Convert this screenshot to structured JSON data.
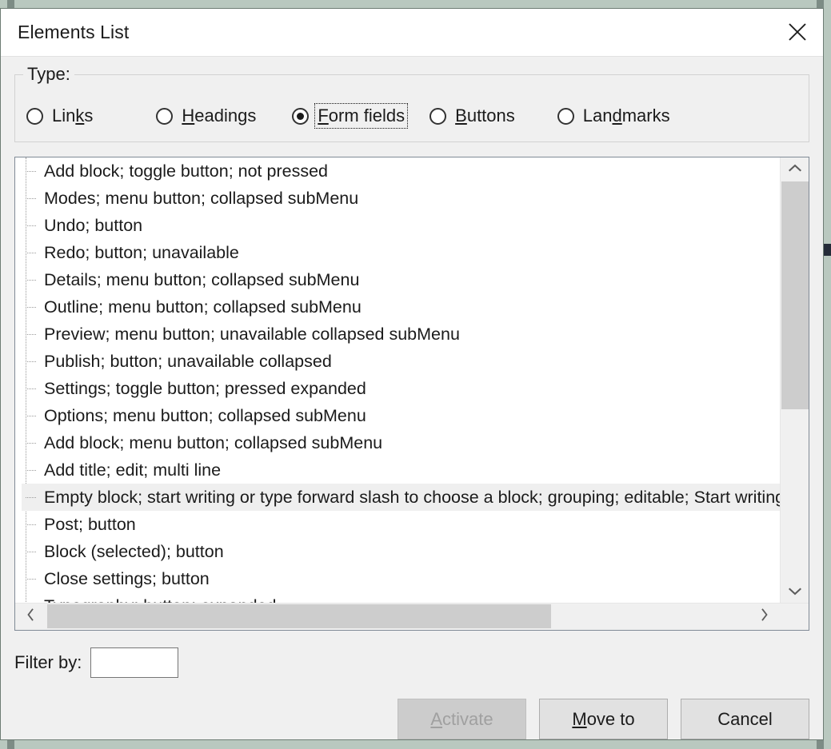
{
  "window": {
    "title": "Elements List",
    "close_icon": "close-icon"
  },
  "type_group": {
    "legend": "Type:",
    "options": [
      {
        "label": "Links",
        "accel_before": "Lin",
        "accel": "k",
        "accel_after": "s",
        "checked": false,
        "focused": false
      },
      {
        "label": "Headings",
        "accel_before": "",
        "accel": "H",
        "accel_after": "eadings",
        "checked": false,
        "focused": false
      },
      {
        "label": "Form fields",
        "accel_before": "",
        "accel": "F",
        "accel_after": "orm fields",
        "checked": true,
        "focused": true
      },
      {
        "label": "Buttons",
        "accel_before": "",
        "accel": "B",
        "accel_after": "uttons",
        "checked": false,
        "focused": false
      },
      {
        "label": "Landmarks",
        "accel_before": "Lan",
        "accel": "d",
        "accel_after": "marks",
        "checked": false,
        "focused": false
      }
    ]
  },
  "list": {
    "rows": [
      {
        "text": "Add block; toggle button; not pressed",
        "selected": false
      },
      {
        "text": "Modes; menu button; collapsed subMenu",
        "selected": false
      },
      {
        "text": "Undo; button",
        "selected": false
      },
      {
        "text": "Redo; button; unavailable",
        "selected": false
      },
      {
        "text": "Details; menu button; collapsed subMenu",
        "selected": false
      },
      {
        "text": "Outline; menu button; collapsed subMenu",
        "selected": false
      },
      {
        "text": "Preview; menu button; unavailable collapsed subMenu",
        "selected": false
      },
      {
        "text": "Publish; button; unavailable collapsed",
        "selected": false
      },
      {
        "text": "Settings; toggle button; pressed expanded",
        "selected": false
      },
      {
        "text": "Options; menu button; collapsed subMenu",
        "selected": false
      },
      {
        "text": "Add block; menu button; collapsed subMenu",
        "selected": false
      },
      {
        "text": "Add title; edit; multi line",
        "selected": false
      },
      {
        "text": "Empty block; start writing or type forward slash to choose a block; grouping; editable; Start writing or type forward slash to choose a block",
        "selected": true
      },
      {
        "text": "Post; button",
        "selected": false
      },
      {
        "text": "Block (selected); button",
        "selected": false
      },
      {
        "text": "Close settings; button",
        "selected": false
      },
      {
        "text": "Typography; button; expanded",
        "selected": false
      }
    ],
    "vertical_scrollbar": {
      "up_icon": "chevron-up-icon",
      "down_icon": "chevron-down-icon"
    },
    "horizontal_scrollbar": {
      "left_icon": "chevron-left-icon",
      "right_icon": "chevron-right-icon"
    }
  },
  "filter": {
    "label": "Filter by:",
    "value": "",
    "placeholder": ""
  },
  "buttons": {
    "activate": {
      "label_before": "",
      "accel": "A",
      "label_after": "ctivate",
      "enabled": false
    },
    "move_to": {
      "label_before": "",
      "accel": "M",
      "label_after": "ove to",
      "enabled": true
    },
    "cancel": {
      "label": "Cancel",
      "enabled": true
    }
  },
  "colors": {
    "dialog_background": "#f0f0f0",
    "titlebar_background": "#ffffff",
    "backdrop": "#b9c8bf",
    "selected_row": "#efefef",
    "scrollbar_thumb": "#cdcdcd",
    "disabled_button": "#cccccc",
    "edge_mark": "#242b38"
  }
}
